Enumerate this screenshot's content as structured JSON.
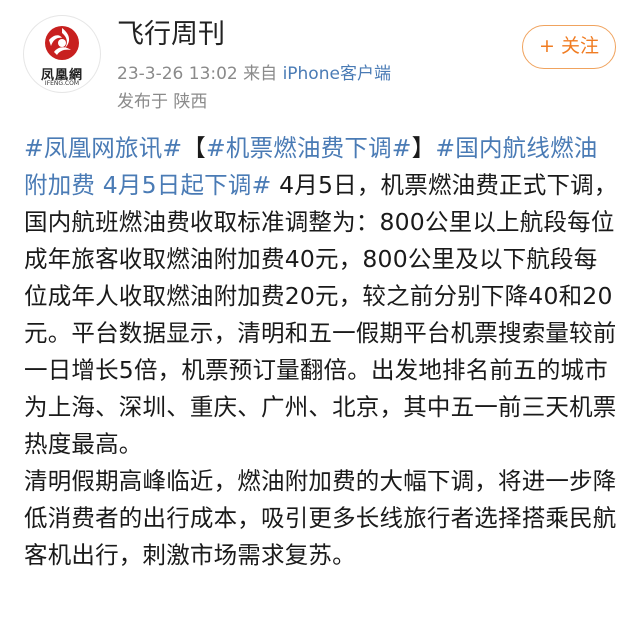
{
  "post": {
    "author": {
      "name": "飞行周刊",
      "avatar_text": "凤凰網",
      "avatar_subtext": "IFENG.COM"
    },
    "date_time": "23-3-26 13:02",
    "source_prefix": "来自",
    "client": "iPhone客户端",
    "location": "发布于 陕西",
    "follow_label": "+ 关注",
    "topics": {
      "t1": "#凤凰网旅讯#",
      "t2": "#机票燃油费下调#",
      "t3": "#国内航线燃油附加费 4月5日起下调#"
    },
    "bracket_open": "【",
    "bracket_close": "】",
    "paragraph1_body": " 4月5日，机票燃油费正式下调，国内航班燃油费收取标准调整为：800公里以上航段每位成年旅客收取燃油附加费40元，800公里及以下航段每位成年人收取燃油附加费20元，较之前分别下降40和20元。平台数据显示，清明和五一假期平台机票搜索量较前一日增长5倍，机票预订量翻倍。出发地排名前五的城市为上海、深圳、重庆、广州、北京，其中五一前三天机票热度最高。",
    "paragraph2": "清明假期高峰临近，燃油附加费的大幅下调，将进一步降低消费者的出行成本，吸引更多长线旅行者选择搭乘民航客机出行，刺激市场需求复苏。"
  },
  "colors": {
    "topic_link": "#4a7bb5",
    "follow_accent": "#f07c22",
    "logo_red": "#c8201f"
  }
}
